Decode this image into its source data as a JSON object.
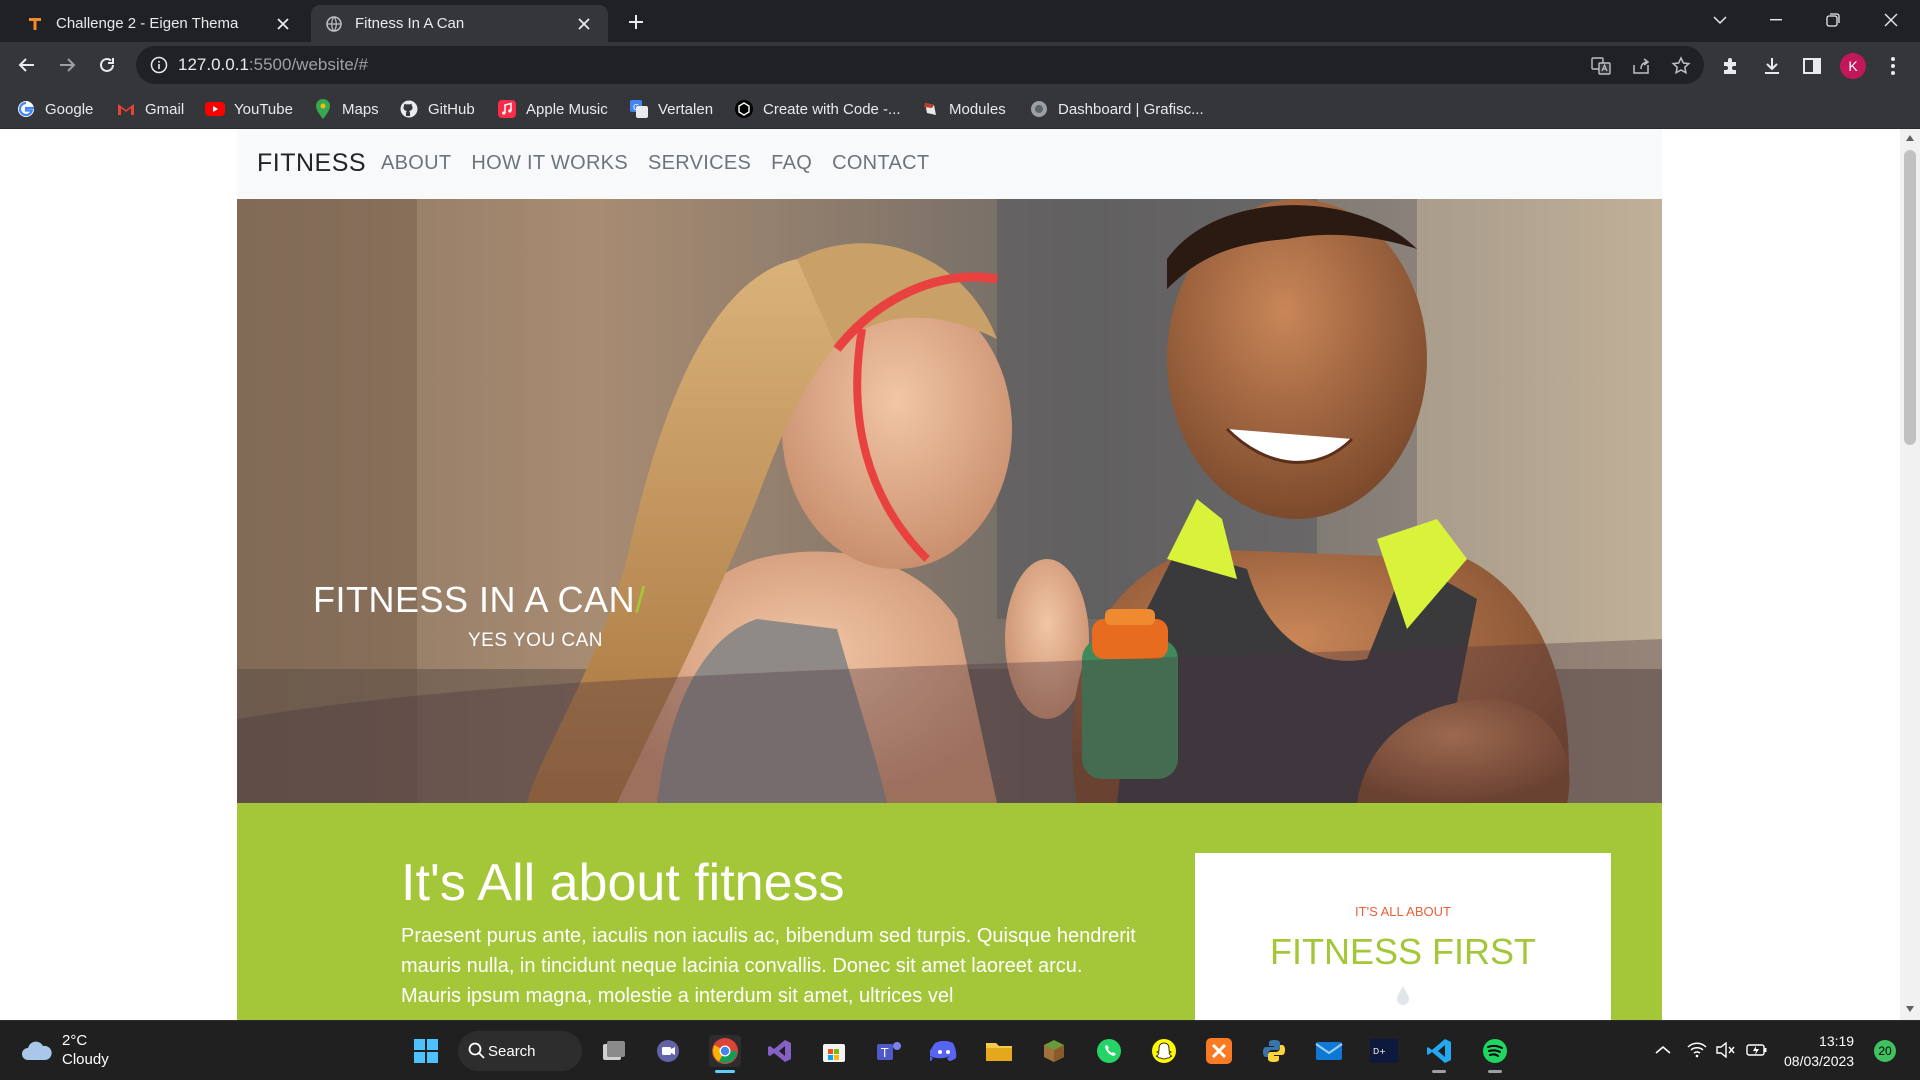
{
  "browser": {
    "tabs": [
      {
        "title": "Challenge 2 - Eigen Thema",
        "favicon": "orange-t-icon",
        "active": false
      },
      {
        "title": "Fitness In A Can",
        "favicon": "globe-icon",
        "active": true
      }
    ],
    "url_host": "127.0.0.1",
    "url_path": ":5500/website/#",
    "profile_initial": "K",
    "bookmarks": [
      {
        "label": "Google",
        "icon": "google-icon"
      },
      {
        "label": "Gmail",
        "icon": "gmail-icon"
      },
      {
        "label": "YouTube",
        "icon": "youtube-icon"
      },
      {
        "label": "Maps",
        "icon": "maps-icon"
      },
      {
        "label": "GitHub",
        "icon": "github-icon"
      },
      {
        "label": "Apple Music",
        "icon": "apple-music-icon"
      },
      {
        "label": "Vertalen",
        "icon": "translate-icon"
      },
      {
        "label": "Create with Code -...",
        "icon": "unity-icon"
      },
      {
        "label": "Modules",
        "icon": "modules-icon"
      },
      {
        "label": "Dashboard | Grafisc...",
        "icon": "dashboard-icon"
      }
    ]
  },
  "site": {
    "brand": "FITNESS",
    "nav": [
      "ABOUT",
      "HOW IT WORKS",
      "SERVICES",
      "FAQ",
      "CONTACT"
    ],
    "hero": {
      "title": "FITNESS IN A CAN",
      "title_mark": "/",
      "subtitle": "YES YOU CAN"
    },
    "about": {
      "heading": "It's All about fitness",
      "body": "Praesent purus ante, iaculis non iaculis ac, bibendum sed turpis. Quisque hendrerit mauris nulla, in tincidunt neque lacinia convallis. Donec sit amet laoreet arcu. Mauris ipsum magna, molestie a interdum sit amet, ultrices vel"
    },
    "card": {
      "kicker": "IT'S ALL ABOUT",
      "title": "FITNESS FIRST"
    },
    "colors": {
      "accent_green": "#a4c639",
      "kicker_orange": "#e8613a"
    }
  },
  "taskbar": {
    "weather_temp": "2°C",
    "weather_desc": "Cloudy",
    "search_label": "Search",
    "time": "13:19",
    "date": "08/03/2023",
    "notifications": "20"
  }
}
